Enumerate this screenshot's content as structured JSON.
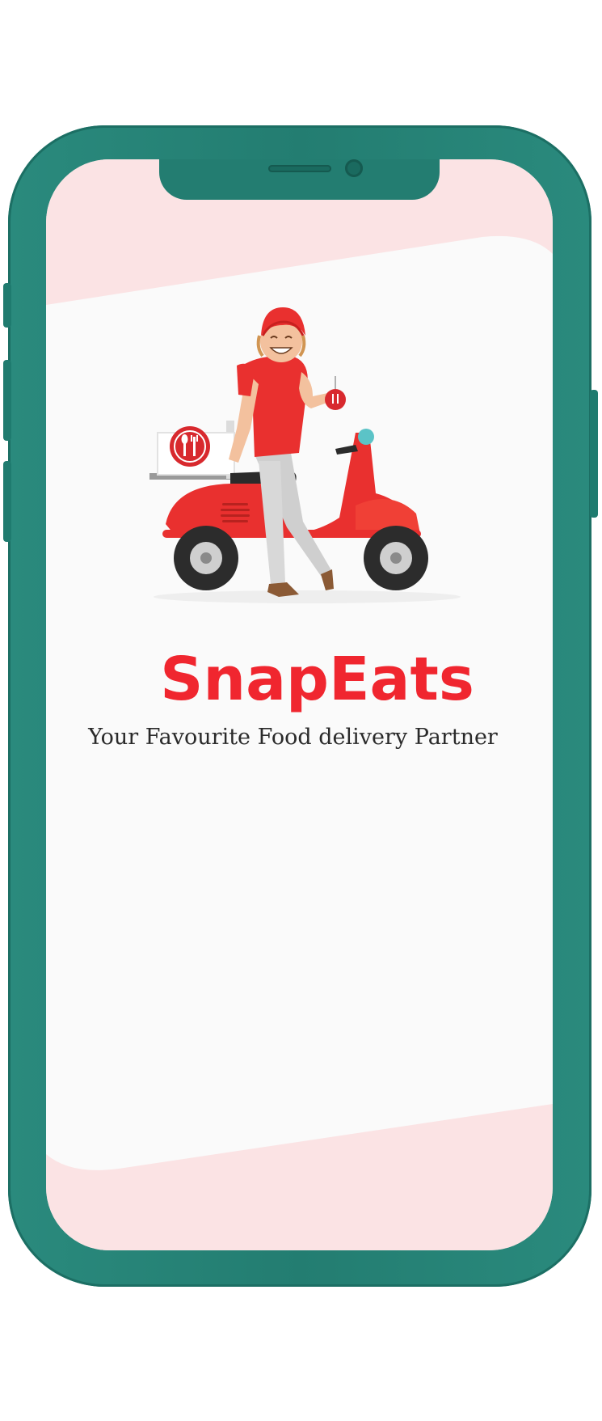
{
  "app": {
    "name": "SnapEats",
    "tagline": "Your Favourite Food delivery Partner"
  },
  "colors": {
    "frame": "#237d71",
    "screen_accent": "#fbe3e4",
    "screen_main": "#fafafa",
    "brand": "#f0262f",
    "tagline": "#2a2a2a"
  },
  "illustration": {
    "subject": "delivery-rider-on-scooter",
    "icons": [
      "fork-spoon-icon"
    ]
  }
}
